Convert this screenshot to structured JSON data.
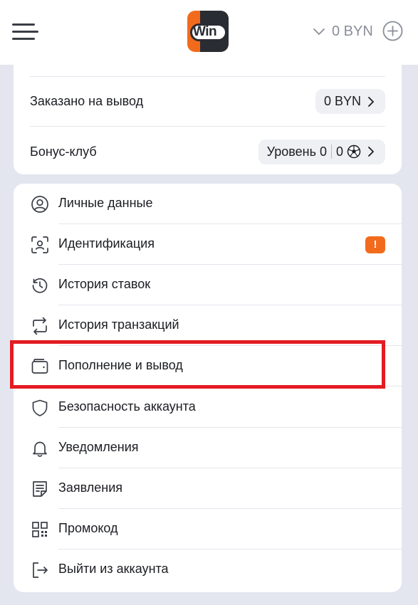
{
  "header": {
    "menu_icon": "hamburger-menu-icon",
    "logo": {
      "text": "Win",
      "colors": {
        "orange": "#f26b1d",
        "dark": "#2a2c33"
      }
    },
    "balance": "0 BYN",
    "balance_icon": "chevron-down-icon",
    "add_icon": "plus-circle-icon"
  },
  "summary": {
    "withdraw": {
      "label": "Заказано на вывод",
      "value": "0 BYN"
    },
    "bonus": {
      "label": "Бонус-клуб",
      "level": "Уровень 0",
      "points": "0",
      "points_icon": "soccer-ball-icon"
    }
  },
  "menu": {
    "items": [
      {
        "label": "Личные данные",
        "icon": "user-circle-icon"
      },
      {
        "label": "Идентификация",
        "icon": "face-id-icon",
        "badge": "!"
      },
      {
        "label": "История ставок",
        "icon": "history-icon"
      },
      {
        "label": "История транзакций",
        "icon": "transfer-icon"
      },
      {
        "label": "Пополнение и вывод",
        "icon": "wallet-icon"
      },
      {
        "label": "Безопасность аккаунта",
        "icon": "shield-icon"
      },
      {
        "label": "Уведомления",
        "icon": "bell-icon"
      },
      {
        "label": "Заявления",
        "icon": "document-icon"
      },
      {
        "label": "Промокод",
        "icon": "qr-code-icon"
      },
      {
        "label": "Выйти из аккаунта",
        "icon": "logout-icon"
      }
    ],
    "highlighted_item": "Пополнение и вывод"
  },
  "colors": {
    "accent": "#f26b1d",
    "highlight": "#e31b23",
    "background": "#e3e6ef"
  }
}
